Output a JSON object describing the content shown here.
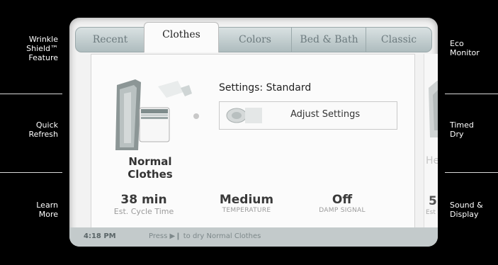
{
  "left_menu": [
    {
      "label": "Wrinkle Shield™ Feature"
    },
    {
      "label": "Quick Refresh"
    },
    {
      "label": "Learn More"
    }
  ],
  "right_menu": [
    {
      "label": "Eco Monitor"
    },
    {
      "label": "Timed Dry"
    },
    {
      "label": "Sound & Display"
    }
  ],
  "tabs": [
    {
      "label": "Recent",
      "active": false
    },
    {
      "label": "Clothes",
      "active": true
    },
    {
      "label": "Colors",
      "active": false
    },
    {
      "label": "Bed & Bath",
      "active": false
    },
    {
      "label": "Classic",
      "active": false
    }
  ],
  "cycle": {
    "name": "Normal Clothes",
    "settings_title": "Settings: Standard",
    "adjust_label": "Adjust Settings",
    "time_value": "38 min",
    "time_label": "Est. Cycle Time",
    "temp_value": "Medium",
    "temp_label": "TEMPERATURE",
    "damp_value": "Off",
    "damp_label": "DAMP SIGNAL"
  },
  "next_card": {
    "name_fragment": "He",
    "value_fragment": "5",
    "label_fragment": "Est"
  },
  "status": {
    "time": "4:18 PM",
    "message": "Press ▶❙ to dry Normal Clothes"
  },
  "colors": {
    "accent_tab": "#aebcbe",
    "panel": "#fbfbfb",
    "status_bar": "#c3cacb"
  }
}
